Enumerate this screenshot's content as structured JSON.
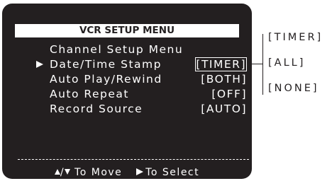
{
  "menu": {
    "title": "VCR SETUP MENU",
    "items": [
      {
        "label": "Channel Setup Menu",
        "value": "",
        "selected": false
      },
      {
        "label": "Date/Time Stamp",
        "value": "[TIMER]",
        "selected": true
      },
      {
        "label": "Auto Play/Rewind",
        "value": "[BOTH]",
        "selected": false
      },
      {
        "label": "Auto Repeat",
        "value": "[OFF]",
        "selected": false
      },
      {
        "label": "Record Source",
        "value": "[AUTO]",
        "selected": false
      }
    ]
  },
  "footer": {
    "move": "To Move",
    "select": "To Select",
    "slash": "/"
  },
  "options": [
    "[TIMER]",
    "[ALL]",
    "[NONE]"
  ],
  "colors": {
    "screen": "#231f20",
    "text": "#ffffff"
  }
}
